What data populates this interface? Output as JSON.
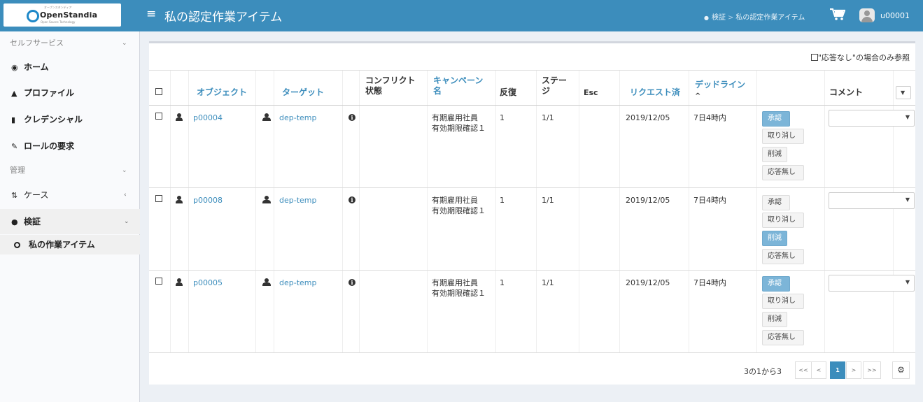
{
  "header": {
    "logo_text": "OpenStandia",
    "logo_tiny": "オープンスタンディア",
    "logo_sub": "Open Source Technology",
    "title": "私の認定作業アイテム",
    "breadcrumb": [
      "検証",
      "私の認定作業アイテム"
    ],
    "username": "u00001"
  },
  "sidebar": {
    "section_self": "セルフサービス",
    "items_self": [
      {
        "label": "ホーム",
        "icon": "dashboard-icon"
      },
      {
        "label": "プロファイル",
        "icon": "user-icon"
      },
      {
        "label": "クレデンシャル",
        "icon": "shield-icon"
      },
      {
        "label": "ロールの要求",
        "icon": "edit-icon"
      }
    ],
    "section_admin": "管理",
    "case_label": "ケース",
    "verify_label": "検証",
    "my_items_label": "私の作業アイテム"
  },
  "filter": {
    "only_no_answer": "\"応答なし\"の場合のみ参照"
  },
  "columns": {
    "object": "オブジェクト",
    "target": "ターゲット",
    "conflict_1": "コンフリクト",
    "conflict_2": "状態",
    "campaign_1": "キャンペーン",
    "campaign_2": "名",
    "iteration": "反復",
    "stage_1": "ステー",
    "stage_2": "ジ",
    "esc": "Esc",
    "requested": "リクエスト済",
    "deadline": "デッドライン",
    "deadline_sort": "^",
    "comment": "コメント"
  },
  "rows": [
    {
      "object": "p00004",
      "target": "dep-temp",
      "campaign_1": "有期雇用社員",
      "campaign_2": "有効期限確認１",
      "iteration": "1",
      "stage": "1/1",
      "requested": "2019/12/05",
      "deadline": "7日4時内"
    },
    {
      "object": "p00008",
      "target": "dep-temp",
      "campaign_1": "有期雇用社員",
      "campaign_2": "有効期限確認１",
      "iteration": "1",
      "stage": "1/1",
      "requested": "2019/12/05",
      "deadline": "7日4時内"
    },
    {
      "object": "p00005",
      "target": "dep-temp",
      "campaign_1": "有期雇用社員",
      "campaign_2": "有効期限確認１",
      "iteration": "1",
      "stage": "1/1",
      "requested": "2019/12/05",
      "deadline": "7日4時内"
    }
  ],
  "actions": {
    "approve": "承認",
    "revoke": "取り消し",
    "reduce": "削減",
    "no_answer": "応答無し"
  },
  "row_selected_action": [
    "approve",
    "reduce",
    "approve"
  ],
  "pagination": {
    "info": "3の1から3",
    "first": "<<",
    "prev": "<",
    "current": "1",
    "next": ">",
    "last": ">>"
  },
  "colors": {
    "header": "#3c8dbc",
    "link": "#3c8dbc",
    "selected_button": "#7cb5d8"
  }
}
